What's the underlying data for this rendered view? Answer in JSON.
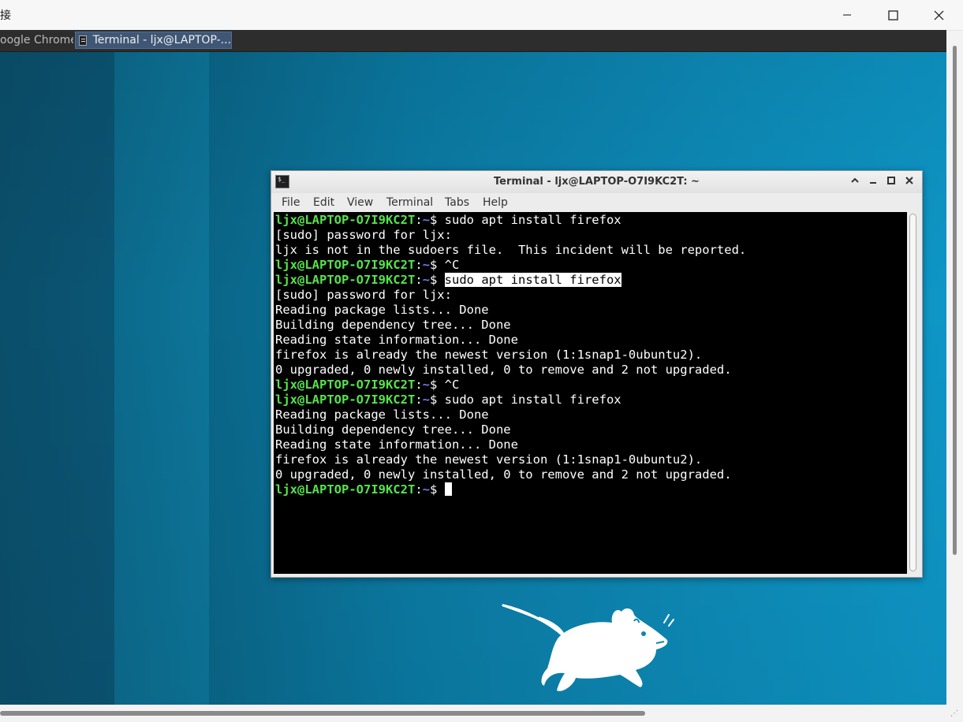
{
  "host": {
    "title": "接",
    "controls": {
      "minimize": "minimize",
      "maximize": "maximize",
      "close": "close"
    }
  },
  "panel": {
    "tasks": [
      {
        "label": "oogle Chrome",
        "icon": "chrome-icon"
      },
      {
        "label": "Terminal - ljx@LAPTOP-...",
        "icon": "terminal-icon"
      }
    ]
  },
  "terminal": {
    "title": "Terminal - ljx@LAPTOP-O7I9KC2T: ~",
    "menu": [
      "File",
      "Edit",
      "View",
      "Terminal",
      "Tabs",
      "Help"
    ],
    "prompt": {
      "user_host": "ljx@LAPTOP-O7I9KC2T",
      "colon": ":",
      "path": "~",
      "symbol": "$ "
    },
    "lines": [
      {
        "type": "prompt",
        "cmd": "sudo apt install firefox"
      },
      {
        "type": "out",
        "text": "[sudo] password for ljx:"
      },
      {
        "type": "out",
        "text": "ljx is not in the sudoers file.  This incident will be reported."
      },
      {
        "type": "prompt",
        "cmd": "^C"
      },
      {
        "type": "prompt",
        "cmd": "sudo apt install firefox",
        "selected": true
      },
      {
        "type": "out",
        "text": "[sudo] password for ljx:"
      },
      {
        "type": "out",
        "text": "Reading package lists... Done"
      },
      {
        "type": "out",
        "text": "Building dependency tree... Done"
      },
      {
        "type": "out",
        "text": "Reading state information... Done"
      },
      {
        "type": "out",
        "text": "firefox is already the newest version (1:1snap1-0ubuntu2)."
      },
      {
        "type": "out",
        "text": "0 upgraded, 0 newly installed, 0 to remove and 2 not upgraded."
      },
      {
        "type": "prompt",
        "cmd": "^C"
      },
      {
        "type": "prompt",
        "cmd": "sudo apt install firefox"
      },
      {
        "type": "out",
        "text": "Reading package lists... Done"
      },
      {
        "type": "out",
        "text": "Building dependency tree... Done"
      },
      {
        "type": "out",
        "text": "Reading state information... Done"
      },
      {
        "type": "out",
        "text": "firefox is already the newest version (1:1snap1-0ubuntu2)."
      },
      {
        "type": "out",
        "text": "0 upgraded, 0 newly installed, 0 to remove and 2 not upgraded."
      },
      {
        "type": "prompt",
        "cmd": "",
        "cursor": true
      }
    ],
    "colors": {
      "user": "#55e34c",
      "path": "#6b7cf2",
      "bg": "#000000",
      "fg": "#ffffff"
    }
  }
}
